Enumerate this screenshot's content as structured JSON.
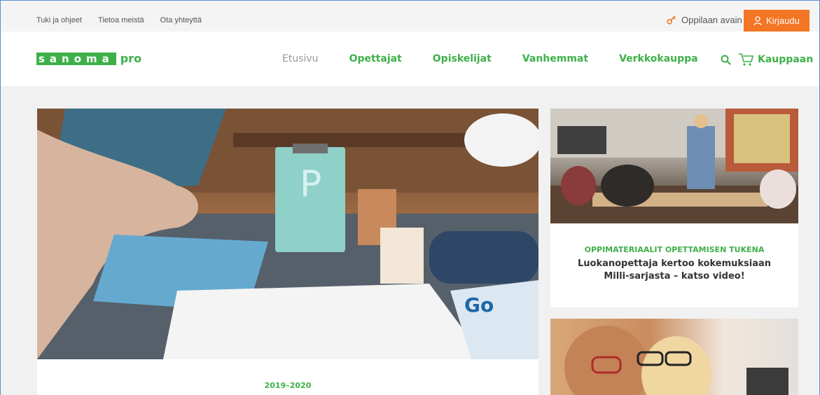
{
  "utility": {
    "links": [
      "Tuki ja ohjeet",
      "Tietoa meistä",
      "Ota yhteyttä"
    ],
    "student_key": "Oppilaan avain",
    "login": "Kirjaudu"
  },
  "header": {
    "logo_brand": "sanoma",
    "logo_suffix": "pro",
    "nav": [
      "Etusivu",
      "Opettajat",
      "Opiskelijat",
      "Vanhemmat",
      "Verkkokauppa"
    ],
    "shop": "Kauppaan"
  },
  "hero": {
    "year": "2019–2020"
  },
  "cards": [
    {
      "kicker": "OPPIMATERIAALIT OPETTAMISEN TUKENA",
      "title": "Luokanopettaja kertoo kokemuksiaan Milli-sarjasta – katso video!"
    }
  ],
  "colors": {
    "brand_green": "#3eb049",
    "login_orange": "#f47524"
  }
}
